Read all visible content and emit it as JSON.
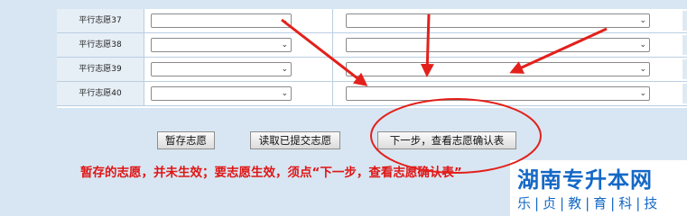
{
  "rows": [
    {
      "label": "平行志愿37"
    },
    {
      "label": "平行志愿38"
    },
    {
      "label": "平行志愿39"
    },
    {
      "label": "平行志愿40"
    }
  ],
  "select_arrow": "⌄",
  "buttons": {
    "save": "暂存志愿",
    "read": "读取已提交志愿",
    "next": "下一步，查看志愿确认表"
  },
  "notice": "暂存的志愿，并未生效；要志愿生效，须点“下一步，查看志愿确认表”",
  "watermark": {
    "title": "湖南专升本网",
    "subtitle": "乐|贞|教|育|科|技"
  },
  "colors": {
    "annotation_red": "#e3201b",
    "notice_red": "#e01515",
    "watermark_blue": "#1468c6"
  }
}
